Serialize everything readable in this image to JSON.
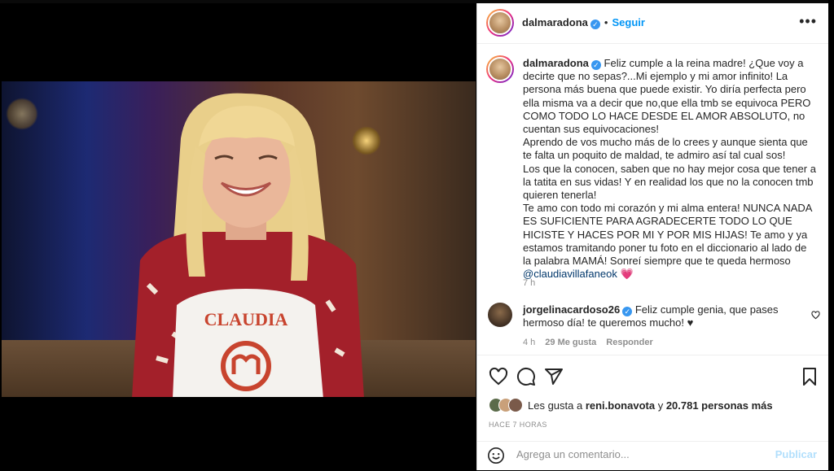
{
  "post": {
    "author": "dalmaradona",
    "follow_label": "Seguir",
    "more_label": "•••",
    "apron_text": "CLAUDIA",
    "caption": {
      "author": "dalmaradona",
      "p1": "Feliz cumple a la reina madre! ¿Que voy a decirte que no sepas?...Mi ejemplo y mi amor infinito! La persona más buena que puede existir. Yo diría perfecta pero ella misma va a decir que no,que ella tmb se equivoca PERO COMO TODO LO HACE DESDE EL AMOR ABSOLUTO, no cuentan sus equivocaciones!",
      "p2": "Aprendo de vos mucho más de lo crees y aunque sienta que te falta un poquito de maldad, te admiro así tal cual sos!",
      "p3": "Los que la conocen, saben que no hay mejor cosa que tener a la tatita en sus vidas! Y en realidad los que no la conocen tmb quieren tenerla!",
      "p4": "Te amo con todo mi corazón y mi alma entera! NUNCA NADA ES SUFICIENTE PARA AGRADECERTE TODO LO QUE HICISTE Y HACES POR MI Y POR MIS HIJAS! Te amo y ya estamos tramitando poner tu foto en el diccionario al lado de la palabra MAMÁ! Sonreí siempre que te queda hermoso",
      "mention": "@claudiavillafaneok",
      "emoji": "💗",
      "time": "7 h"
    },
    "comment": {
      "author": "jorgelinacardoso26",
      "text": "Feliz cumple genia, que pases hermoso día! te queremos mucho! ♥",
      "time": "4 h",
      "likes": "29 Me gusta",
      "reply": "Responder"
    },
    "likes": {
      "prefix": "Les gusta a ",
      "user": "reni.bonavota",
      "middle": " y ",
      "count": "20.781 personas más"
    },
    "posted_ago": "HACE 7 HORAS",
    "add_comment": {
      "placeholder": "Agrega un comentario...",
      "publish": "Publicar"
    }
  }
}
